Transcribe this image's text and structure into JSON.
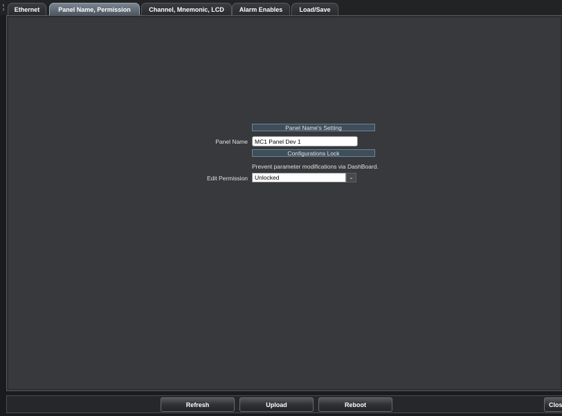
{
  "tabs": [
    {
      "label": "Ethernet"
    },
    {
      "label": "Panel Name, Permission"
    },
    {
      "label": "Channel, Mnemonic, LCD"
    },
    {
      "label": "Alarm Enables"
    },
    {
      "label": "Load/Save"
    }
  ],
  "active_tab": "Panel Name, Permission",
  "panel_section": {
    "header": "Panel Name's Setting",
    "panel_name_label": "Panel Name",
    "panel_name_value": "MC1 Panel Dev 1"
  },
  "lock_section": {
    "header": "Configurations Lock",
    "hint": "Prevent parameter modifications via DashBoard.",
    "edit_permission_label": "Edit Permission",
    "edit_permission_value": "Unlocked"
  },
  "buttons": {
    "refresh": "Refresh",
    "upload": "Upload",
    "reboot": "Reboot",
    "close": "Close"
  },
  "icons": {
    "tab_scroll": "chevron-left-right-icon",
    "dropdown": "chevron-down-icon"
  }
}
